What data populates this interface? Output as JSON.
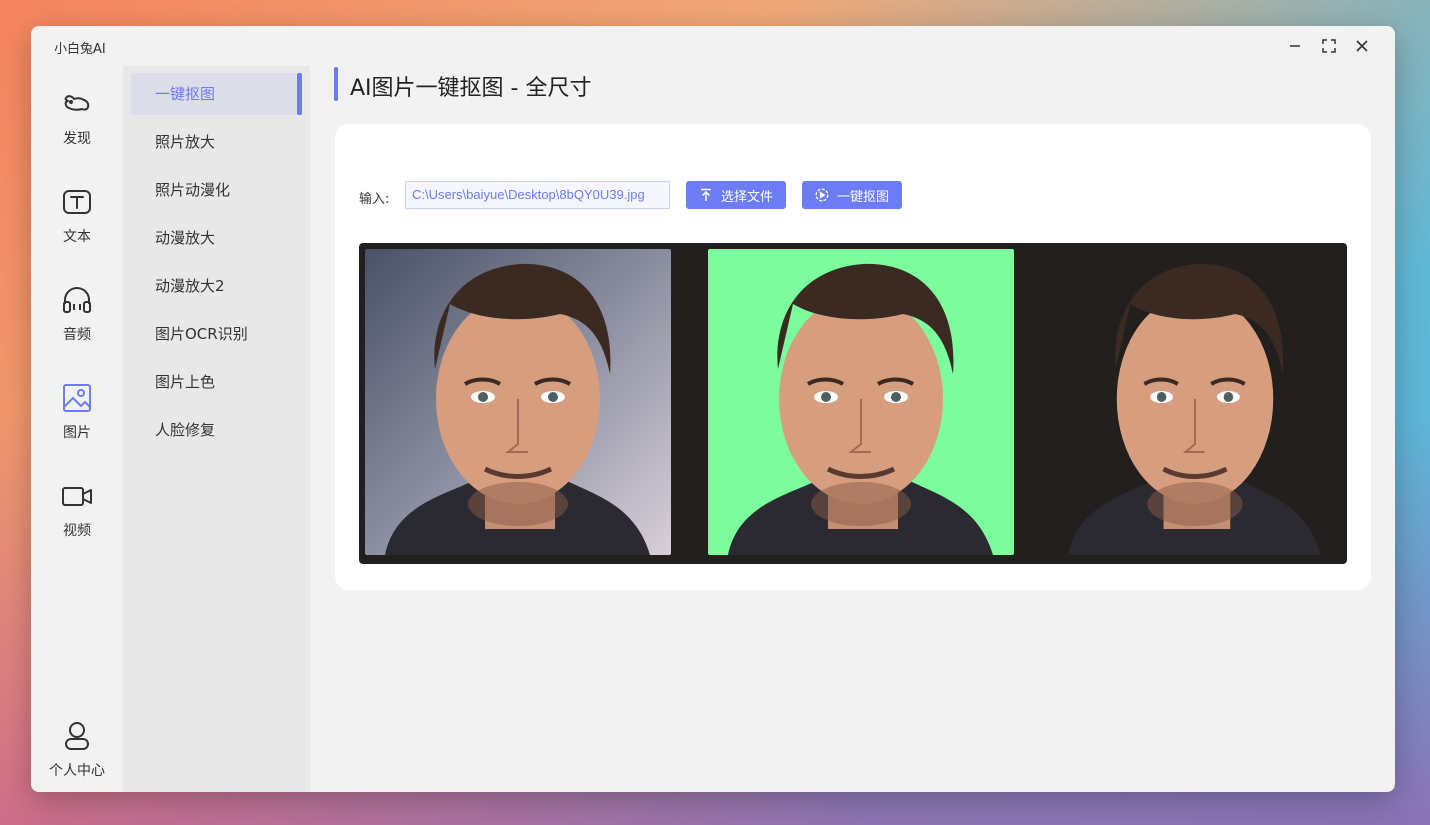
{
  "window": {
    "app_title": "小白兔AI",
    "controls": [
      "minimize-icon",
      "maximize-icon",
      "close-icon"
    ]
  },
  "rail": {
    "items": [
      {
        "label": "发现",
        "icon": "bunny-icon"
      },
      {
        "label": "文本",
        "icon": "text-icon"
      },
      {
        "label": "音频",
        "icon": "headphones-icon"
      },
      {
        "label": "图片",
        "icon": "image-icon",
        "active": true
      },
      {
        "label": "视频",
        "icon": "video-camera-icon"
      }
    ],
    "bottom": {
      "label": "个人中心",
      "icon": "user-icon"
    }
  },
  "subnav": {
    "items": [
      {
        "label": "一键抠图",
        "active": true
      },
      {
        "label": "照片放大"
      },
      {
        "label": "照片动漫化"
      },
      {
        "label": "动漫放大"
      },
      {
        "label": "动漫放大2"
      },
      {
        "label": "图片OCR识别"
      },
      {
        "label": "图片上色"
      },
      {
        "label": "人脸修复"
      }
    ]
  },
  "main": {
    "title": "AI图片一键抠图 - 全尺寸",
    "input_label": "输入:",
    "input_value": "C:\\Users\\baiyue\\Desktop\\8bQY0U39.jpg",
    "select_file_label": "选择文件",
    "run_label": "一键抠图",
    "preview": {
      "panels": [
        "original",
        "mask-green",
        "cutout"
      ]
    }
  },
  "colors": {
    "accent": "#6b7cf5",
    "green_matte": "#7cfc9c",
    "preview_bg": "#221f1f"
  }
}
